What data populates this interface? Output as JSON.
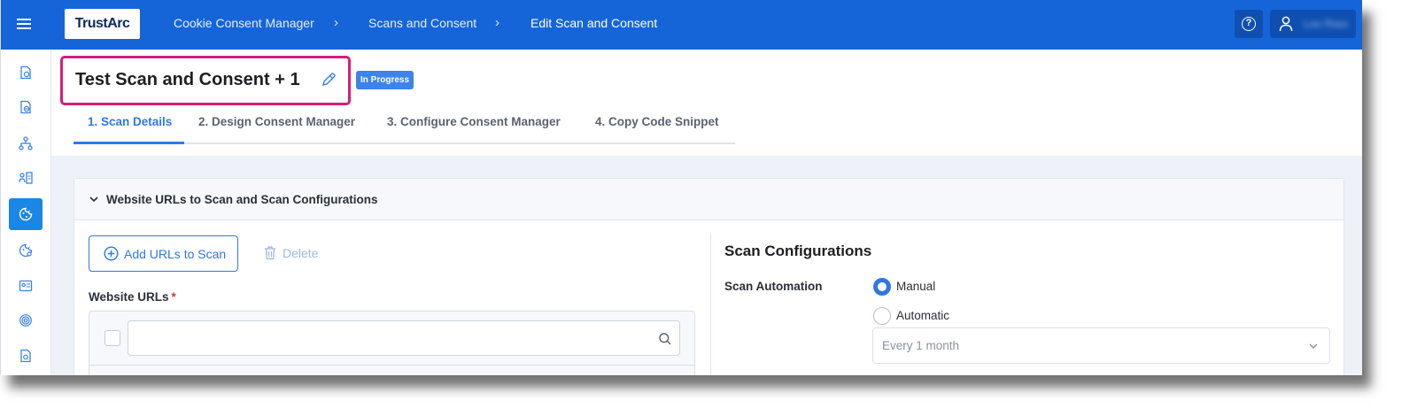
{
  "topbar": {
    "logo": "TrustArc",
    "breadcrumbs": [
      "Cookie Consent Manager",
      "Scans and Consent",
      "Edit Scan and Consent"
    ],
    "user_name": "Lee Riwo",
    "bg_color": "#1565d8"
  },
  "sidebar": {
    "items": [
      {
        "icon": "document-clock-icon",
        "active": false
      },
      {
        "icon": "document-globe-icon",
        "active": false
      },
      {
        "icon": "hierarchy-icon",
        "active": false
      },
      {
        "icon": "user-list-icon",
        "active": false
      },
      {
        "icon": "cookie-icon",
        "active": true
      },
      {
        "icon": "cookie-settings-icon",
        "active": false
      },
      {
        "icon": "id-card-icon",
        "active": false
      },
      {
        "icon": "fingerprint-icon",
        "active": false
      },
      {
        "icon": "document-settings-icon",
        "active": false
      }
    ]
  },
  "page": {
    "title": "Test Scan and Consent + 1",
    "status": "In Progress",
    "tabs": [
      {
        "label": "1. Scan Details",
        "active": true
      },
      {
        "label": "2. Design Consent Manager",
        "active": false
      },
      {
        "label": "3. Configure Consent Manager",
        "active": false
      },
      {
        "label": "4. Copy Code Snippet",
        "active": false
      }
    ]
  },
  "panel": {
    "title": "Website URLs to Scan and Scan Configurations",
    "add_urls_label": "Add URLs to Scan",
    "delete_label": "Delete",
    "urls_label": "Website URLs",
    "required_mark": "*",
    "search_value": "",
    "scan_config": {
      "title": "Scan Configurations",
      "automation_label": "Scan Automation",
      "options": [
        {
          "label": "Manual",
          "checked": true
        },
        {
          "label": "Automatic",
          "checked": false
        }
      ],
      "frequency": "Every 1 month"
    }
  },
  "colors": {
    "accent": "#2f78e3",
    "highlight_border": "#d81b7a",
    "required": "#e0333a"
  }
}
